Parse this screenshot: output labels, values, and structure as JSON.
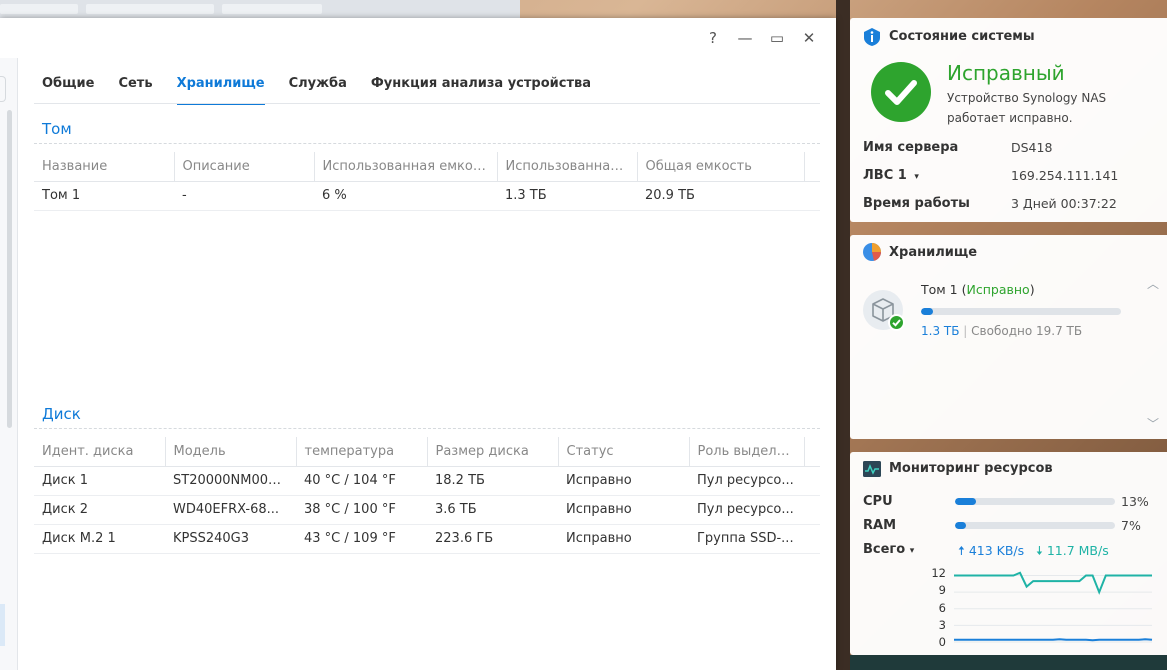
{
  "window": {
    "controls": {
      "help": "?",
      "minimize": "—",
      "maximize": "▭",
      "close": "✕"
    },
    "tabs": [
      {
        "label": "Общие",
        "active": false
      },
      {
        "label": "Сеть",
        "active": false
      },
      {
        "label": "Хранилище",
        "active": true
      },
      {
        "label": "Служба",
        "active": false
      },
      {
        "label": "Функция анализа устройства",
        "active": false
      }
    ],
    "volume_section": {
      "title": "Том",
      "columns": [
        "Название",
        "Описание",
        "Использованная емкос...",
        "Использованная...",
        "Общая емкость"
      ],
      "rows": [
        [
          "Том 1",
          "-",
          "6 %",
          "1.3 ТБ",
          "20.9 ТБ"
        ]
      ]
    },
    "disk_section": {
      "title": "Диск",
      "columns": [
        "Идент. диска",
        "Модель",
        "температура",
        "Размер диска",
        "Статус",
        "Роль выделе..."
      ],
      "rows": [
        [
          "Диск 1",
          "ST20000NM007...",
          "40 °C / 104 °F",
          "18.2 ТБ",
          "Исправно",
          "Пул ресурсо..."
        ],
        [
          "Диск 2",
          "WD40EFRX-68...",
          "38 °C / 100 °F",
          "3.6 ТБ",
          "Исправно",
          "Пул ресурсо..."
        ],
        [
          "Диск M.2 1",
          "KPSS240G3",
          "43 °C / 109 °F",
          "223.6 ГБ",
          "Исправно",
          "Группа SSD-..."
        ]
      ]
    }
  },
  "system_health": {
    "title": "Состояние системы",
    "status": "Исправный",
    "description": "Устройство Synology NAS работает исправно.",
    "server_name_label": "Имя сервера",
    "server_name": "DS418",
    "lan_label": "ЛВС 1",
    "lan_ip": "169.254.111.141",
    "uptime_label": "Время работы",
    "uptime": "3 Дней 00:37:22"
  },
  "storage_widget": {
    "title": "Хранилище",
    "volume_name": "Том 1",
    "volume_status": "Исправно",
    "used": "1.3 ТБ",
    "separator": "|",
    "free": "Свободно 19.7 ТБ",
    "usage_fraction": 0.06
  },
  "resource_monitor": {
    "title": "Мониторинг ресурсов",
    "cpu_label": "CPU",
    "cpu_pct": "13%",
    "cpu_fraction": 0.13,
    "ram_label": "RAM",
    "ram_pct": "7%",
    "ram_fraction": 0.07,
    "total_label": "Всего",
    "upload": "413 KB/s",
    "download": "11.7 MB/s",
    "colors": {
      "upload": "#1a7fd9",
      "download": "#1fb3a6"
    }
  },
  "chart_data": {
    "type": "line",
    "y_ticks": [
      "12",
      "9",
      "6",
      "3",
      "0"
    ],
    "ylim": [
      0,
      13
    ],
    "series": [
      {
        "values": [
          12,
          12,
          12,
          12,
          12,
          12,
          12,
          12,
          12,
          12,
          12.5,
          10,
          11,
          11,
          11,
          11,
          11,
          11,
          11,
          11,
          12,
          12,
          9,
          12,
          12,
          12,
          12,
          12,
          12,
          12,
          12
        ],
        "color": "#1fb3a6"
      },
      {
        "values": [
          0.4,
          0.4,
          0.4,
          0.4,
          0.4,
          0.4,
          0.4,
          0.4,
          0.4,
          0.4,
          0.4,
          0.4,
          0.4,
          0.4,
          0.4,
          0.4,
          0.5,
          0.4,
          0.4,
          0.4,
          0.4,
          0.3,
          0.4,
          0.4,
          0.4,
          0.4,
          0.4,
          0.4,
          0.4,
          0.5,
          0.4
        ],
        "color": "#1a7fd9"
      }
    ]
  }
}
